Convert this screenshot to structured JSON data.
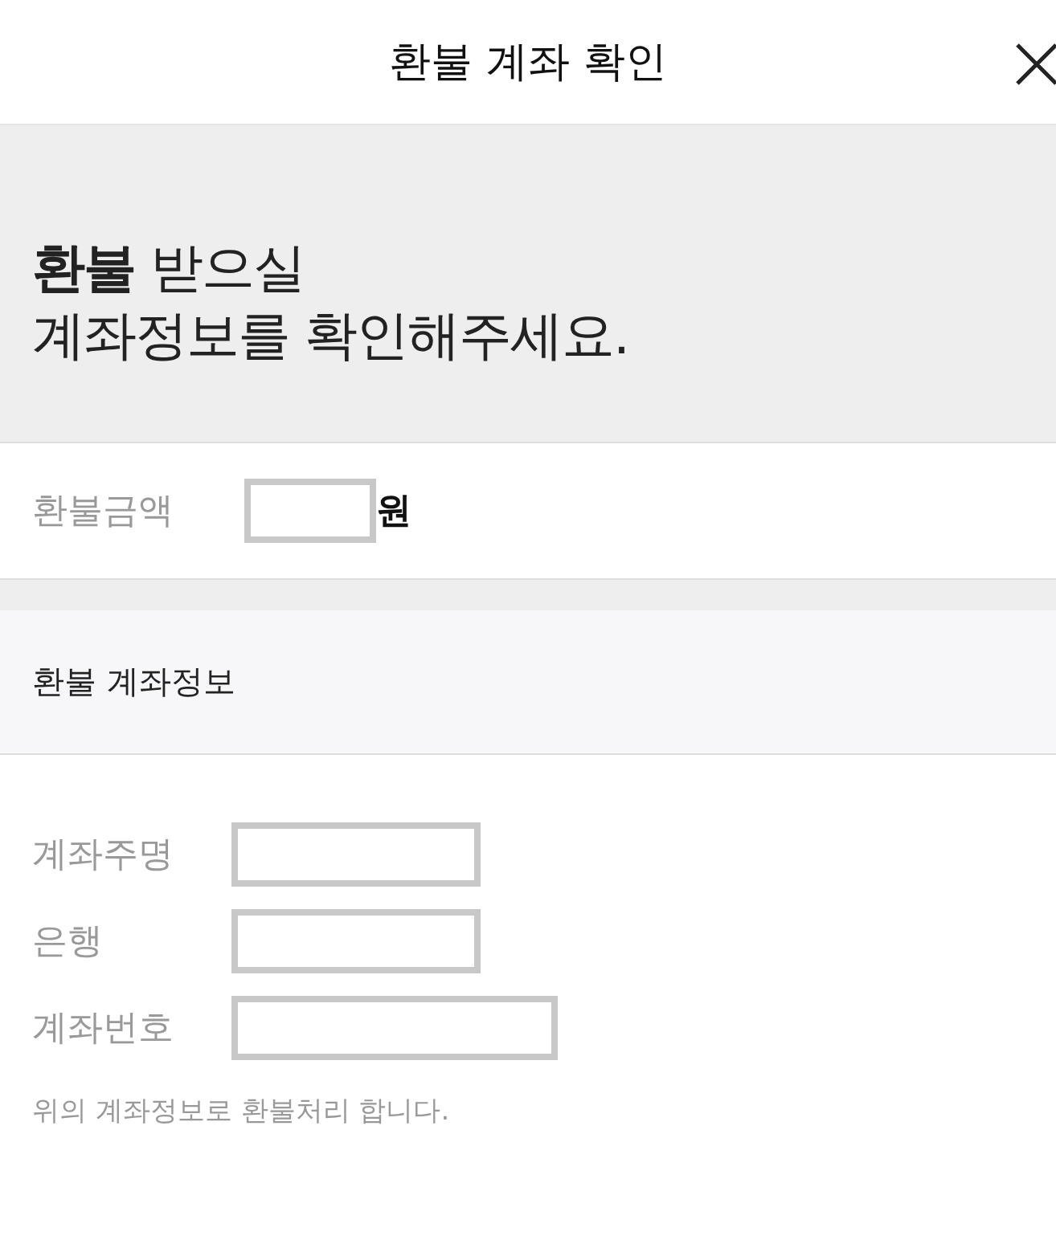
{
  "header": {
    "title": "환불 계좌 확인"
  },
  "banner": {
    "lines": [
      "**환불** 받으실",
      "계좌정보를 확인해주세요."
    ]
  },
  "amount": {
    "label": "환불금액",
    "unit": "원"
  },
  "section": {
    "title": "환불 계좌정보"
  },
  "fields": [
    {
      "label": "계좌주명",
      "kind": "short"
    },
    {
      "label": "은행",
      "kind": "short"
    },
    {
      "label": "계좌번호",
      "kind": "long"
    }
  ],
  "note": "위의 계좌정보로 환불처리 합니다."
}
